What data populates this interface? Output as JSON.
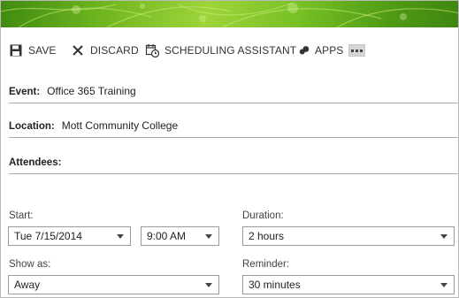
{
  "toolbar": {
    "save_label": "SAVE",
    "discard_label": "DISCARD",
    "scheduling_label": "SCHEDULING ASSISTANT",
    "apps_label": "APPS"
  },
  "form": {
    "event_label": "Event:",
    "event_value": "Office 365 Training",
    "location_label": "Location:",
    "location_value": "Mott Community College",
    "attendees_label": "Attendees:",
    "attendees_value": ""
  },
  "schedule": {
    "start_label": "Start:",
    "start_date": "Tue 7/15/2014",
    "start_time": "9:00 AM",
    "duration_label": "Duration:",
    "duration_value": "2 hours",
    "show_as_label": "Show as:",
    "show_as_value": "Away",
    "reminder_label": "Reminder:",
    "reminder_value": "30 minutes"
  },
  "colors": {
    "banner_dark": "#3f8a11",
    "banner_light": "#9ed43a"
  },
  "icons": {
    "save": "floppy-disk-icon",
    "discard": "x-icon",
    "scheduling": "calendar-clock-icon",
    "apps": "apps-icon",
    "more": "ellipsis-icon"
  }
}
